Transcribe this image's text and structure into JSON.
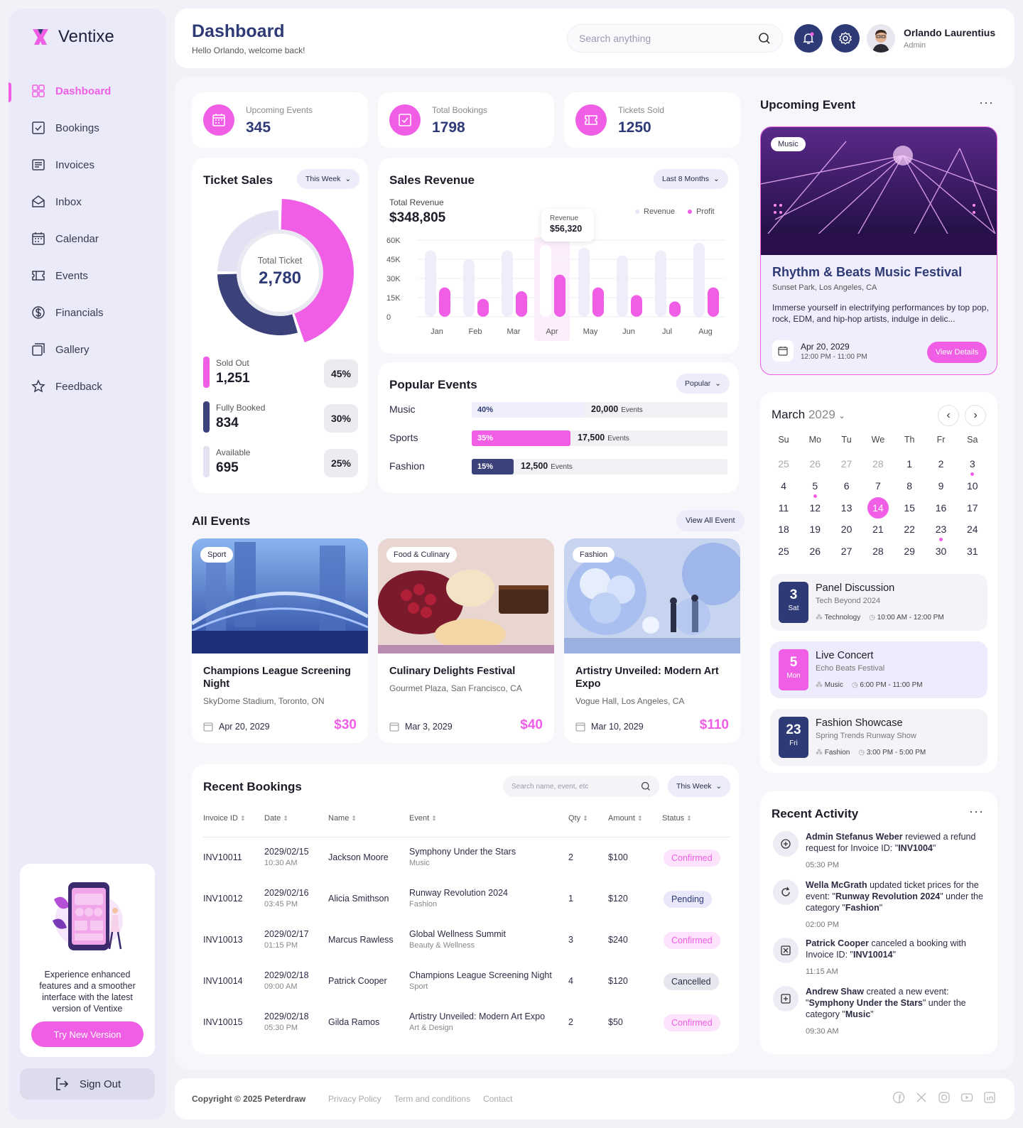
{
  "brand": {
    "name": "Ventixe",
    "accent": "#f05ee6",
    "navy": "#2e3a75"
  },
  "nav": [
    {
      "label": "Dashboard",
      "icon": "grid-icon",
      "active": true
    },
    {
      "label": "Bookings",
      "icon": "checkbox-icon"
    },
    {
      "label": "Invoices",
      "icon": "invoice-icon"
    },
    {
      "label": "Inbox",
      "icon": "inbox-icon"
    },
    {
      "label": "Calendar",
      "icon": "calendar-icon"
    },
    {
      "label": "Events",
      "icon": "ticket-icon"
    },
    {
      "label": "Financials",
      "icon": "dollar-icon"
    },
    {
      "label": "Gallery",
      "icon": "gallery-icon"
    },
    {
      "label": "Feedback",
      "icon": "star-icon"
    }
  ],
  "promo": {
    "text": "Experience enhanced features and a smoother interface with the latest version of Ventixe",
    "button": "Try New Version"
  },
  "signout": "Sign Out",
  "header": {
    "title": "Dashboard",
    "subtitle": "Hello Orlando, welcome back!",
    "search_placeholder": "Search anything",
    "user_name": "Orlando Laurentius",
    "user_role": "Admin"
  },
  "stats": [
    {
      "label": "Upcoming Events",
      "value": "345",
      "icon": "calendar-icon"
    },
    {
      "label": "Total Bookings",
      "value": "1798",
      "icon": "checkbox-icon"
    },
    {
      "label": "Tickets Sold",
      "value": "1250",
      "icon": "ticket-icon"
    }
  ],
  "ticket_sales": {
    "title": "Ticket Sales",
    "filter": "This Week",
    "center_label": "Total Ticket",
    "center_value": "2,780",
    "items": [
      {
        "label": "Sold Out",
        "value": "1,251",
        "pct": "45%",
        "fraction": 0.45,
        "color": "#f05ee6"
      },
      {
        "label": "Fully Booked",
        "value": "834",
        "pct": "30%",
        "fraction": 0.3,
        "color": "#3b4279"
      },
      {
        "label": "Available",
        "value": "695",
        "pct": "25%",
        "fraction": 0.25,
        "color": "#e2e2f2"
      }
    ]
  },
  "sales_revenue": {
    "title": "Sales Revenue",
    "filter": "Last 8 Months",
    "total_label": "Total Revenue",
    "total_value": "$348,805",
    "tooltip_label": "Revenue",
    "tooltip_value": "$56,320"
  },
  "chart_data": {
    "type": "bar",
    "categories": [
      "Jan",
      "Feb",
      "Mar",
      "Apr",
      "May",
      "Jun",
      "Jul",
      "Aug"
    ],
    "series": [
      {
        "name": "Revenue",
        "values": [
          52000,
          45000,
          52000,
          56320,
          54000,
          48000,
          52000,
          58000
        ],
        "color": "#eeeefb"
      },
      {
        "name": "Profit",
        "values": [
          23000,
          14000,
          20000,
          33000,
          23000,
          17000,
          12000,
          23000
        ],
        "color": "#f05ee6"
      }
    ],
    "yticks": [
      "60K",
      "45K",
      "30K",
      "15K",
      "0"
    ],
    "ylim": [
      0,
      60000
    ],
    "highlight": "Apr",
    "legend": "top-right"
  },
  "popular": {
    "title": "Popular Events",
    "filter": "Popular",
    "items": [
      {
        "name": "Music",
        "pct": "40%",
        "fraction": 0.4,
        "count": "20,000",
        "unit": "Events",
        "color": "#eeeefc",
        "text": "#2e3a75"
      },
      {
        "name": "Sports",
        "pct": "35%",
        "fraction": 0.35,
        "count": "17,500",
        "unit": "Events",
        "color": "#f05ee6",
        "text": "#ffffff"
      },
      {
        "name": "Fashion",
        "pct": "15%",
        "fraction": 0.15,
        "count": "12,500",
        "unit": "Events",
        "color": "#3b4279",
        "text": "#ffffff"
      }
    ]
  },
  "all_events": {
    "title": "All Events",
    "view_all": "View All Event",
    "items": [
      {
        "tag": "Sport",
        "name": "Champions League Screening Night",
        "location": "SkyDome Stadium, Toronto, ON",
        "date": "Apr 20, 2029",
        "price": "$30"
      },
      {
        "tag": "Food & Culinary",
        "name": "Culinary Delights Festival",
        "location": "Gourmet Plaza, San Francisco, CA",
        "date": "Mar 3, 2029",
        "price": "$40"
      },
      {
        "tag": "Fashion",
        "name": "Artistry Unveiled: Modern Art Expo",
        "location": "Vogue Hall, Los Angeles, CA",
        "date": "Mar 10, 2029",
        "price": "$110"
      }
    ]
  },
  "bookings": {
    "title": "Recent Bookings",
    "search_placeholder": "Search name, event, etc",
    "filter": "This Week",
    "headers": [
      "Invoice ID",
      "Date",
      "Name",
      "Event",
      "Qty",
      "Amount",
      "Status"
    ],
    "rows": [
      {
        "id": "INV10011",
        "date": "2029/02/15",
        "time": "10:30 AM",
        "name": "Jackson Moore",
        "event": "Symphony Under the Stars",
        "cat": "Music",
        "qty": "2",
        "amount": "$100",
        "status": "Confirmed"
      },
      {
        "id": "INV10012",
        "date": "2029/02/16",
        "time": "03:45 PM",
        "name": "Alicia Smithson",
        "event": "Runway Revolution 2024",
        "cat": "Fashion",
        "qty": "1",
        "amount": "$120",
        "status": "Pending"
      },
      {
        "id": "INV10013",
        "date": "2029/02/17",
        "time": "01:15 PM",
        "name": "Marcus Rawless",
        "event": "Global Wellness Summit",
        "cat": "Beauty & Wellness",
        "qty": "3",
        "amount": "$240",
        "status": "Confirmed"
      },
      {
        "id": "INV10014",
        "date": "2029/02/18",
        "time": "09:00 AM",
        "name": "Patrick Cooper",
        "event": "Champions League Screening Night",
        "cat": "Sport",
        "qty": "4",
        "amount": "$120",
        "status": "Cancelled"
      },
      {
        "id": "INV10015",
        "date": "2029/02/18",
        "time": "05:30 PM",
        "name": "Gilda Ramos",
        "event": "Artistry Unveiled: Modern Art Expo",
        "cat": "Art & Design",
        "qty": "2",
        "amount": "$50",
        "status": "Confirmed"
      }
    ]
  },
  "upcoming": {
    "title": "Upcoming Event",
    "tag": "Music",
    "name": "Rhythm & Beats Music Festival",
    "location": "Sunset Park, Los Angeles, CA",
    "description": "Immerse yourself in electrifying performances by top pop, rock, EDM, and hip-hop artists, indulge in delic...",
    "date": "Apr 20, 2029",
    "time": "12:00 PM - 11:00 PM",
    "button": "View Details"
  },
  "calendar": {
    "month": "March",
    "year": "2029",
    "weekdays": [
      "Su",
      "Mo",
      "Tu",
      "We",
      "Th",
      "Fr",
      "Sa"
    ],
    "days": [
      "25",
      "26",
      "27",
      "28",
      "1",
      "2",
      "3",
      "4",
      "5",
      "6",
      "7",
      "8",
      "9",
      "10",
      "11",
      "12",
      "13",
      "14",
      "15",
      "16",
      "17",
      "18",
      "19",
      "20",
      "21",
      "22",
      "23",
      "24",
      "25",
      "26",
      "27",
      "28",
      "29",
      "30",
      "31"
    ],
    "muted_count": 4,
    "selected": "14",
    "dots": [
      "3",
      "5",
      "23"
    ]
  },
  "schedule": [
    {
      "day": "3",
      "dow": "Sat",
      "title": "Panel Discussion",
      "sub": "Tech Beyond 2024",
      "cat": "Technology",
      "time": "10:00 AM - 12:00 PM",
      "style": "navy"
    },
    {
      "day": "5",
      "dow": "Mon",
      "title": "Live Concert",
      "sub": "Echo Beats Festival",
      "cat": "Music",
      "time": "6:00 PM - 11:00 PM",
      "style": "pink"
    },
    {
      "day": "23",
      "dow": "Fri",
      "title": "Fashion Showcase",
      "sub": "Spring Trends Runway Show",
      "cat": "Fashion",
      "time": "3:00 PM - 5:00 PM",
      "style": "navy"
    }
  ],
  "activity": {
    "title": "Recent Activity",
    "items": [
      {
        "icon": "refund-icon",
        "time": "05:30 PM",
        "html": [
          [
            "b",
            "Admin Stefanus Weber"
          ],
          [
            "t",
            " reviewed a refund request for Invoice ID: \""
          ],
          [
            "b",
            "INV1004"
          ],
          [
            "t",
            "\""
          ]
        ]
      },
      {
        "icon": "refresh-icon",
        "time": "02:00 PM",
        "html": [
          [
            "b",
            "Wella McGrath"
          ],
          [
            "t",
            " updated ticket prices for the event: \""
          ],
          [
            "b",
            "Runway Revolution 2024"
          ],
          [
            "t",
            "\" under the category \""
          ],
          [
            "b",
            "Fashion"
          ],
          [
            "t",
            "\""
          ]
        ]
      },
      {
        "icon": "cancel-icon",
        "time": "11:15 AM",
        "html": [
          [
            "b",
            "Patrick Cooper"
          ],
          [
            "t",
            " canceled a booking with Invoice ID: \""
          ],
          [
            "b",
            "INV10014"
          ],
          [
            "t",
            "\""
          ]
        ]
      },
      {
        "icon": "add-icon",
        "time": "09:30 AM",
        "html": [
          [
            "b",
            "Andrew Shaw"
          ],
          [
            "t",
            " created a new event: \""
          ],
          [
            "b",
            "Symphony Under the Stars"
          ],
          [
            "t",
            "\" under the category \""
          ],
          [
            "b",
            "Music"
          ],
          [
            "t",
            "\""
          ]
        ]
      }
    ]
  },
  "footer": {
    "copyright": "Copyright © 2025 Peterdraw",
    "links": [
      "Privacy Policy",
      "Term and conditions",
      "Contact"
    ],
    "socials": [
      "facebook-icon",
      "x-icon",
      "instagram-icon",
      "youtube-icon",
      "linkedin-icon"
    ]
  }
}
